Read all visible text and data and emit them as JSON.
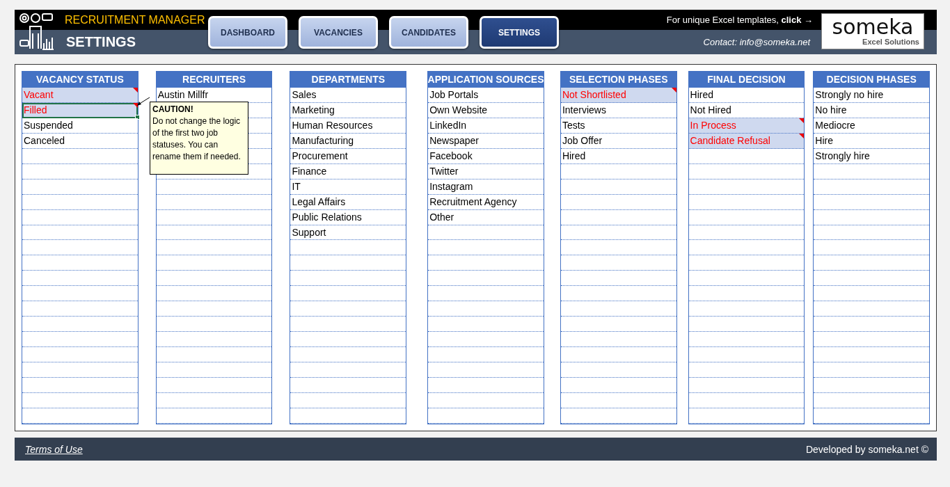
{
  "header": {
    "app_title": "RECRUITMENT MANAGER",
    "page_title": "SETTINGS",
    "promo_text": "For unique Excel templates, **click →**",
    "contact": "Contact: info@someka.net",
    "logo_name": "someka",
    "logo_tagline": "Excel Solutions"
  },
  "nav": [
    {
      "label": "DASHBOARD",
      "selected": false
    },
    {
      "label": "VACANCIES",
      "selected": false
    },
    {
      "label": "CANDIDATES",
      "selected": false
    },
    {
      "label": "SETTINGS",
      "selected": true
    }
  ],
  "lists": [
    {
      "title": "VACANCY STATUS",
      "items": [
        {
          "text": "Vacant",
          "locked": true,
          "selected": false
        },
        {
          "text": "Filled",
          "locked": true,
          "selected": true
        },
        {
          "text": "Suspended",
          "locked": false,
          "selected": false
        },
        {
          "text": "Canceled",
          "locked": false,
          "selected": false
        }
      ]
    },
    {
      "title": "RECRUITERS",
      "items": [
        {
          "text": "Austin Millfr",
          "locked": false,
          "selected": false
        }
      ]
    },
    {
      "title": "DEPARTMENTS",
      "items": [
        {
          "text": "Sales",
          "locked": false,
          "selected": false
        },
        {
          "text": "Marketing",
          "locked": false,
          "selected": false
        },
        {
          "text": "Human Resources",
          "locked": false,
          "selected": false
        },
        {
          "text": "Manufacturing",
          "locked": false,
          "selected": false
        },
        {
          "text": "Procurement",
          "locked": false,
          "selected": false
        },
        {
          "text": "Finance",
          "locked": false,
          "selected": false
        },
        {
          "text": "IT",
          "locked": false,
          "selected": false
        },
        {
          "text": "Legal Affairs",
          "locked": false,
          "selected": false
        },
        {
          "text": "Public Relations",
          "locked": false,
          "selected": false
        },
        {
          "text": "Support",
          "locked": false,
          "selected": false
        }
      ]
    },
    {
      "title": "APPLICATION SOURCES",
      "items": [
        {
          "text": "Job Portals",
          "locked": false,
          "selected": false
        },
        {
          "text": "Own Website",
          "locked": false,
          "selected": false
        },
        {
          "text": "LinkedIn",
          "locked": false,
          "selected": false
        },
        {
          "text": "Newspaper",
          "locked": false,
          "selected": false
        },
        {
          "text": "Facebook",
          "locked": false,
          "selected": false
        },
        {
          "text": "Twitter",
          "locked": false,
          "selected": false
        },
        {
          "text": "Instagram",
          "locked": false,
          "selected": false
        },
        {
          "text": "Recruitment Agency",
          "locked": false,
          "selected": false
        },
        {
          "text": "Other",
          "locked": false,
          "selected": false
        }
      ]
    },
    {
      "title": "SELECTION PHASES",
      "items": [
        {
          "text": "Not Shortlisted",
          "locked": true,
          "selected": false
        },
        {
          "text": "Interviews",
          "locked": false,
          "selected": false
        },
        {
          "text": "Tests",
          "locked": false,
          "selected": false
        },
        {
          "text": "Job Offer",
          "locked": false,
          "selected": false
        },
        {
          "text": "Hired",
          "locked": false,
          "selected": false
        }
      ]
    },
    {
      "title": "FINAL DECISION",
      "items": [
        {
          "text": "Hired",
          "locked": false,
          "selected": false
        },
        {
          "text": "Not Hired",
          "locked": false,
          "selected": false
        },
        {
          "text": "In Process",
          "locked": true,
          "selected": false
        },
        {
          "text": "Candidate Refusal",
          "locked": true,
          "selected": false
        }
      ]
    },
    {
      "title": "DECISION PHASES",
      "items": [
        {
          "text": "Strongly no hire",
          "locked": false,
          "selected": false
        },
        {
          "text": "No hire",
          "locked": false,
          "selected": false
        },
        {
          "text": "Mediocre",
          "locked": false,
          "selected": false
        },
        {
          "text": "Hire",
          "locked": false,
          "selected": false
        },
        {
          "text": "Strongly hire",
          "locked": false,
          "selected": false
        }
      ]
    }
  ],
  "comment": {
    "title": "CAUTION!",
    "body": "Do not change the logic of the first two job statuses. You can rename them if needed."
  },
  "footer": {
    "terms_link": "Terms of Use",
    "credit": "Developed by someka.net ©"
  }
}
